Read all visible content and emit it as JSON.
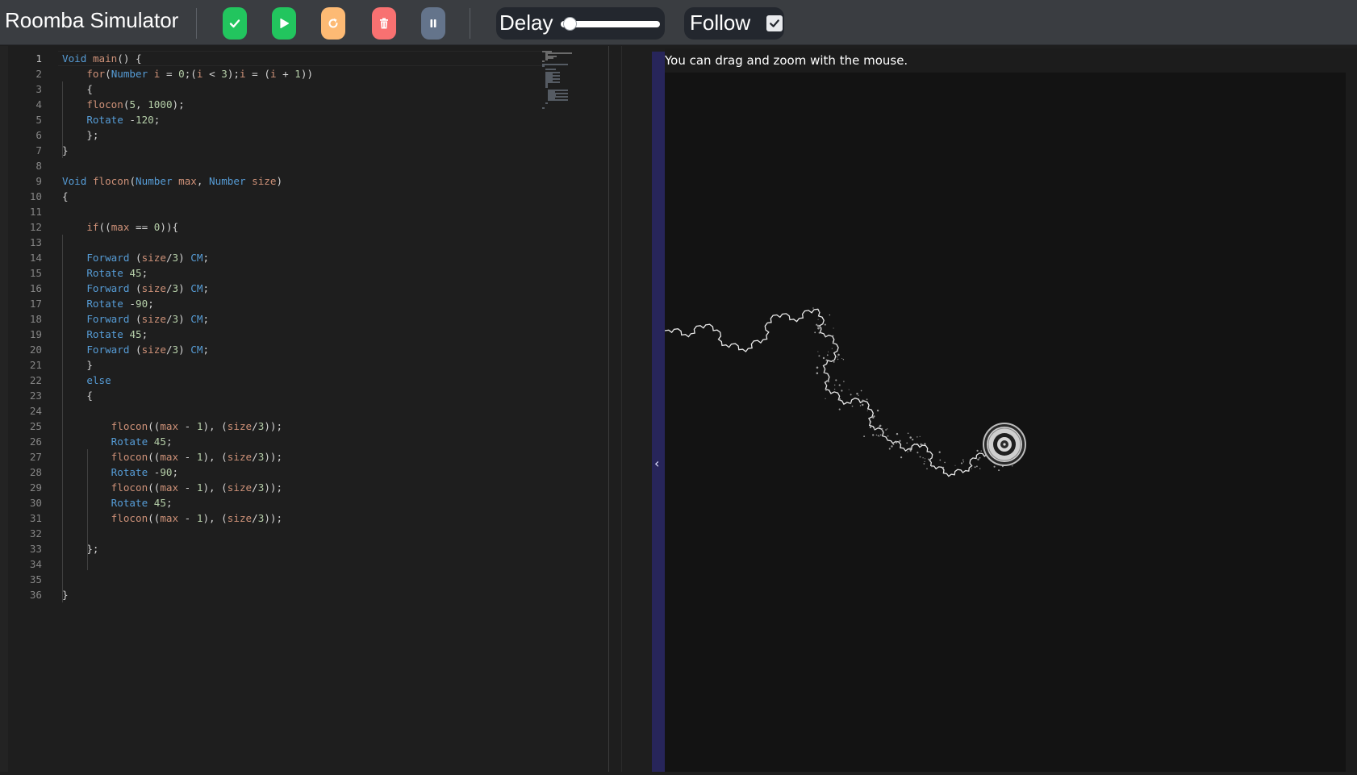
{
  "app": {
    "title": "Roomba Simulator"
  },
  "toolbar": {
    "buttons": [
      {
        "name": "check-button",
        "icon": "check-icon",
        "color": "#22c55e"
      },
      {
        "name": "run-button",
        "icon": "play-icon",
        "color": "#22c55e"
      },
      {
        "name": "restart-button",
        "icon": "restart-icon",
        "color": "#fdba74"
      },
      {
        "name": "delete-button",
        "icon": "trash-icon",
        "color": "#f87171"
      },
      {
        "name": "pause-button",
        "icon": "pause-icon",
        "color": "#64748b"
      }
    ],
    "delay": {
      "label": "Delay",
      "value": 0.05
    },
    "follow": {
      "label": "Follow",
      "checked": true
    }
  },
  "editor": {
    "current_line": 1,
    "lines": [
      {
        "n": "1",
        "t": "Void main() {"
      },
      {
        "n": "2",
        "t": "    for(Number i = 0;(i < 3);i = (i + 1))"
      },
      {
        "n": "3",
        "t": "    {"
      },
      {
        "n": "4",
        "t": "    flocon(5, 1000);"
      },
      {
        "n": "5",
        "t": "    Rotate -120;"
      },
      {
        "n": "6",
        "t": "    };"
      },
      {
        "n": "7",
        "t": "}"
      },
      {
        "n": "8",
        "t": ""
      },
      {
        "n": "9",
        "t": "Void flocon(Number max, Number size)"
      },
      {
        "n": "10",
        "t": "{"
      },
      {
        "n": "11",
        "t": ""
      },
      {
        "n": "12",
        "t": "    if((max == 0)){"
      },
      {
        "n": "13",
        "t": ""
      },
      {
        "n": "14",
        "t": "    Forward (size/3) CM;"
      },
      {
        "n": "15",
        "t": "    Rotate 45;"
      },
      {
        "n": "16",
        "t": "    Forward (size/3) CM;"
      },
      {
        "n": "17",
        "t": "    Rotate -90;"
      },
      {
        "n": "18",
        "t": "    Forward (size/3) CM;"
      },
      {
        "n": "19",
        "t": "    Rotate 45;"
      },
      {
        "n": "20",
        "t": "    Forward (size/3) CM;"
      },
      {
        "n": "21",
        "t": "    }"
      },
      {
        "n": "22",
        "t": "    else"
      },
      {
        "n": "23",
        "t": "    {"
      },
      {
        "n": "24",
        "t": ""
      },
      {
        "n": "25",
        "t": "        flocon((max - 1), (size/3));"
      },
      {
        "n": "26",
        "t": "        Rotate 45;"
      },
      {
        "n": "27",
        "t": "        flocon((max - 1), (size/3));"
      },
      {
        "n": "28",
        "t": "        Rotate -90;"
      },
      {
        "n": "29",
        "t": "        flocon((max - 1), (size/3));"
      },
      {
        "n": "30",
        "t": "        Rotate 45;"
      },
      {
        "n": "31",
        "t": "        flocon((max - 1), (size/3));"
      },
      {
        "n": "32",
        "t": ""
      },
      {
        "n": "33",
        "t": "    };"
      },
      {
        "n": "34",
        "t": ""
      },
      {
        "n": "35",
        "t": ""
      },
      {
        "n": "36",
        "t": "}"
      }
    ]
  },
  "simulator": {
    "hint": "You can drag and zoom with the mouse.",
    "splitter_icon": "chevron-left-icon"
  }
}
